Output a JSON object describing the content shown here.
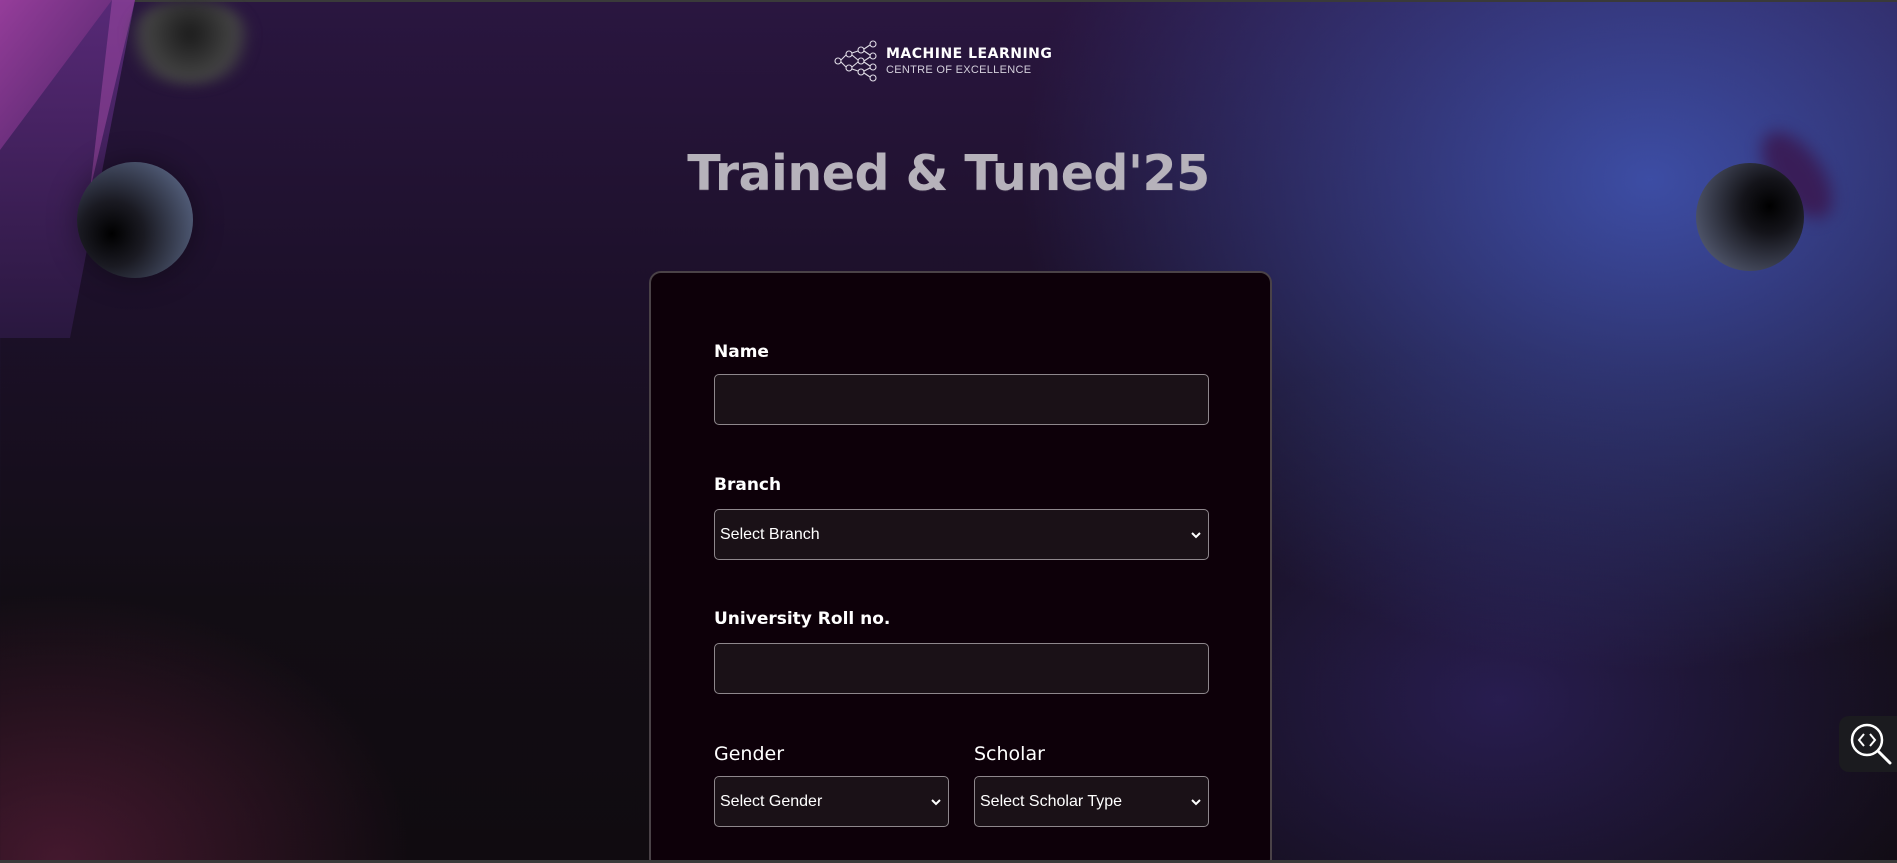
{
  "logo": {
    "line1": "MACHINE LEARNING",
    "line2": "CENTRE OF EXCELLENCE",
    "icon": "neural-network-icon"
  },
  "title": "Trained & Tuned'25",
  "form": {
    "name_label": "Name",
    "name_value": "",
    "branch_label": "Branch",
    "branch_value": "Select Branch",
    "roll_label": "University Roll no.",
    "roll_value": "",
    "gender_label": "Gender",
    "gender_value": "Select Gender",
    "scholar_label": "Scholar",
    "scholar_value": "Select Scholar Type"
  },
  "side_button": {
    "icon": "code-search-icon"
  },
  "colors": {
    "card_bg": "#0d0009",
    "input_bg": "#1a1117",
    "accent_blue": "#3e50aa",
    "accent_purple": "#8a3c8c"
  }
}
